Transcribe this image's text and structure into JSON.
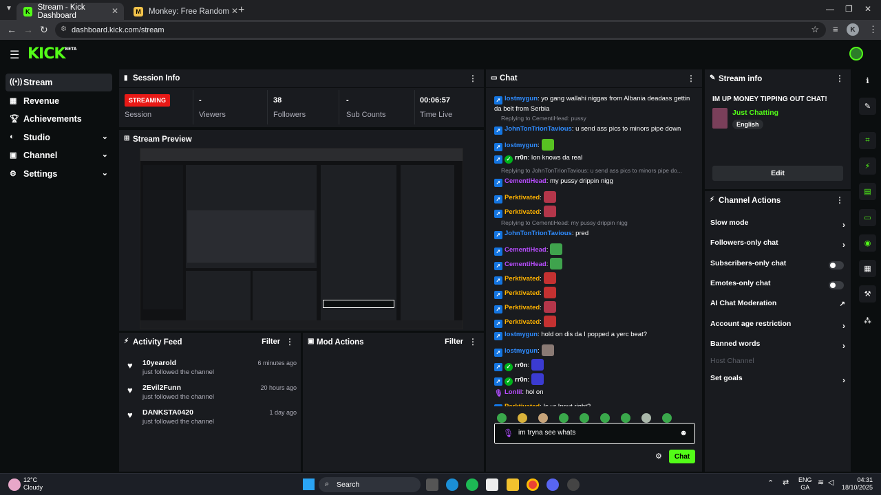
{
  "browser": {
    "tabs": [
      {
        "title": "Stream - Kick Dashboard",
        "active": true
      },
      {
        "title": "Monkey: Free Random Video C",
        "active": false
      }
    ],
    "url": "dashboard.kick.com/stream"
  },
  "header": {
    "logo": "KICK",
    "logo_sup": "BETA"
  },
  "sidebar": {
    "items": [
      {
        "label": "Stream",
        "icon": "broadcast-icon",
        "active": true
      },
      {
        "label": "Revenue",
        "icon": "revenue-icon"
      },
      {
        "label": "Achievements",
        "icon": "trophy-icon"
      },
      {
        "label": "Studio",
        "icon": "studio-icon",
        "chevron": true
      },
      {
        "label": "Channel",
        "icon": "channel-icon",
        "chevron": true
      },
      {
        "label": "Settings",
        "icon": "gear-icon",
        "chevron": true
      }
    ]
  },
  "session": {
    "title": "Session Info",
    "badge": "STREAMING",
    "badge_label": "Session",
    "stats": [
      {
        "value": "-",
        "label": "Viewers"
      },
      {
        "value": "38",
        "label": "Followers"
      },
      {
        "value": "-",
        "label": "Sub Counts"
      },
      {
        "value": "00:06:57",
        "label": "Time Live"
      }
    ]
  },
  "preview": {
    "title": "Stream Preview"
  },
  "activity": {
    "title": "Activity Feed",
    "filter": "Filter",
    "items": [
      {
        "name": "10yearold",
        "sub": "just followed the channel",
        "time": "6 minutes ago"
      },
      {
        "name": "2Evil2Funn",
        "sub": "just followed the channel",
        "time": "20 hours ago"
      },
      {
        "name": "DANKSTA0420",
        "sub": "just followed the channel",
        "time": "1 day ago"
      }
    ]
  },
  "mod": {
    "title": "Mod Actions",
    "filter": "Filter"
  },
  "chat": {
    "title": "Chat",
    "messages": [
      {
        "user": "lostmygun",
        "badge": "lost",
        "color": "#2f8cff",
        "text": ": yo gang wallahi niggas from Albania deadass gettin da belt from Serbia"
      },
      {
        "reply": "Replying to CementiHead: pussy"
      },
      {
        "user": "JohnTonTrionTavious",
        "badge": "lost",
        "color": "#2f8cff",
        "text": ": u send ass pics to minors pipe down"
      },
      {
        "user": "lostmygun",
        "badge": "lost",
        "color": "#2f8cff",
        "text": ":",
        "emote": "#58c322"
      },
      {
        "user": "rr0n",
        "badge": "both",
        "color": "#ffffff",
        "text": ": Ion knows da real"
      },
      {
        "reply": "Replying to JohnTonTrionTavious: u send ass pics to minors pipe do..."
      },
      {
        "user": "CementiHead",
        "badge": "lost",
        "color": "#b84dff",
        "text": ": my pussy drippin nigg"
      },
      {
        "user": "Perktivated",
        "badge": "lost",
        "color": "#ffb300",
        "text": ":",
        "emote": "#b3364a"
      },
      {
        "user": "Perktivated",
        "badge": "lost",
        "color": "#ffb300",
        "text": ":",
        "emote": "#b3364a"
      },
      {
        "reply": "Replying to CementiHead: my pussy drippin nigg"
      },
      {
        "user": "JohnTonTrionTavious",
        "badge": "lost",
        "color": "#2f8cff",
        "text": ": pred"
      },
      {
        "user": "CementiHead",
        "badge": "lost",
        "color": "#b84dff",
        "text": ":",
        "emote": "#3fa34d"
      },
      {
        "user": "CementiHead",
        "badge": "lost",
        "color": "#b84dff",
        "text": ":",
        "emote": "#3fa34d"
      },
      {
        "user": "Perktivated",
        "badge": "lost",
        "color": "#ffb300",
        "text": ":",
        "emote": "#c43131"
      },
      {
        "user": "Perktivated",
        "badge": "lost",
        "color": "#ffb300",
        "text": ":",
        "emote": "#c43131"
      },
      {
        "user": "Perktivated",
        "badge": "lost",
        "color": "#ffb300",
        "text": ":",
        "emote": "#b3364a"
      },
      {
        "user": "Perktivated",
        "badge": "lost",
        "color": "#ffb300",
        "text": ":",
        "emote": "#c43131"
      },
      {
        "user": "lostmygun",
        "badge": "lost",
        "color": "#2f8cff",
        "text": ": hold on dis da I popped a yerc beat?"
      },
      {
        "user": "lostmygun",
        "badge": "lost",
        "color": "#2f8cff",
        "text": ":",
        "emote": "#8a7a74"
      },
      {
        "user": "rr0n",
        "badge": "both",
        "color": "#ffffff",
        "text": ":",
        "emote": "#3b3bd1"
      },
      {
        "user": "rr0n",
        "badge": "both",
        "color": "#ffffff",
        "text": ":",
        "emote": "#3b3bd1"
      },
      {
        "user": "Lonlil",
        "badge": "mic",
        "color": "#b84dff",
        "text": ": hol on"
      },
      {
        "user": "Perktivated",
        "badge": "lost",
        "color": "#ffb300",
        "text": ": Is ur Input right?"
      }
    ],
    "input_text": "im tryna see whats",
    "send_label": "Chat"
  },
  "stream_info": {
    "title": "Stream info",
    "stream_title": "IM UP MONEY TIPPING OUT CHAT!",
    "category": "Just Chatting",
    "language": "English",
    "edit": "Edit"
  },
  "channel_actions": {
    "title": "Channel Actions",
    "items": [
      {
        "label": "Slow mode",
        "control": "arrow"
      },
      {
        "label": "Followers-only chat",
        "control": "arrow"
      },
      {
        "label": "Subscribers-only chat",
        "control": "toggle"
      },
      {
        "label": "Emotes-only chat",
        "control": "toggle"
      },
      {
        "label": "AI Chat Moderation",
        "control": "external"
      },
      {
        "label": "Account age restriction",
        "control": "arrow"
      },
      {
        "label": "Banned words",
        "control": "arrow"
      },
      {
        "label": "Host Channel",
        "control": "none",
        "disabled": true
      },
      {
        "label": "Set goals",
        "control": "arrow"
      }
    ]
  },
  "taskbar": {
    "weather_temp": "12°C",
    "weather_desc": "Cloudy",
    "search": "Search",
    "lang1": "ENG",
    "lang2": "GA",
    "time": "04:31",
    "date": "18/10/2025"
  },
  "colors": {
    "accent": "#53fc18",
    "live": "#e91916"
  }
}
